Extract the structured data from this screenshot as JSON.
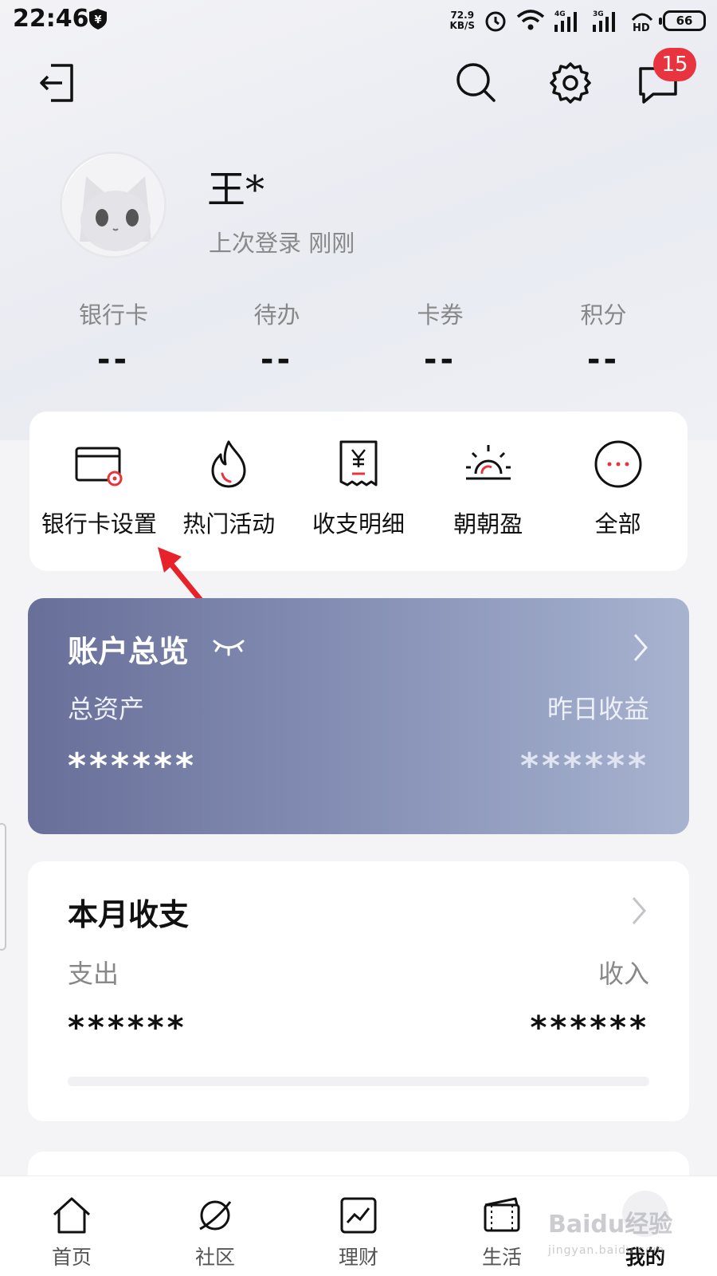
{
  "status_bar": {
    "time": "22:46",
    "net_speed_value": "72.9",
    "net_speed_unit": "KB/S",
    "battery": "66"
  },
  "header": {
    "message_badge": "15"
  },
  "profile": {
    "name": "王*",
    "last_login": "上次登录 刚刚"
  },
  "stats": [
    {
      "label": "银行卡",
      "value": "--"
    },
    {
      "label": "待办",
      "value": "--"
    },
    {
      "label": "卡券",
      "value": "--"
    },
    {
      "label": "积分",
      "value": "--"
    }
  ],
  "quick_menu": [
    {
      "label": "银行卡设置",
      "icon": "bank-card-settings-icon"
    },
    {
      "label": "热门活动",
      "icon": "fire-icon"
    },
    {
      "label": "收支明细",
      "icon": "receipt-icon"
    },
    {
      "label": "朝朝盈",
      "icon": "sunrise-icon"
    },
    {
      "label": "全部",
      "icon": "more-icon"
    }
  ],
  "account_overview": {
    "title": "账户总览",
    "total_assets_label": "总资产",
    "yesterday_income_label": "昨日收益",
    "total_assets_value": "******",
    "yesterday_income_value": "******"
  },
  "monthly": {
    "title": "本月收支",
    "expense_label": "支出",
    "income_label": "收入",
    "expense_value": "******",
    "income_value": "******"
  },
  "bottom_nav": [
    {
      "label": "首页",
      "icon": "home-icon"
    },
    {
      "label": "社区",
      "icon": "planet-icon"
    },
    {
      "label": "理财",
      "icon": "chart-icon"
    },
    {
      "label": "生活",
      "icon": "wallet-icon"
    },
    {
      "label": "我的",
      "icon": "avatar-icon",
      "active": true
    }
  ],
  "watermark": {
    "text": "Baidu经验",
    "sub": "jingyan.baidu.com"
  },
  "colors": {
    "accent_red": "#e8343f",
    "card_gradient_start": "#686f99",
    "card_gradient_end": "#a7b3cf"
  }
}
